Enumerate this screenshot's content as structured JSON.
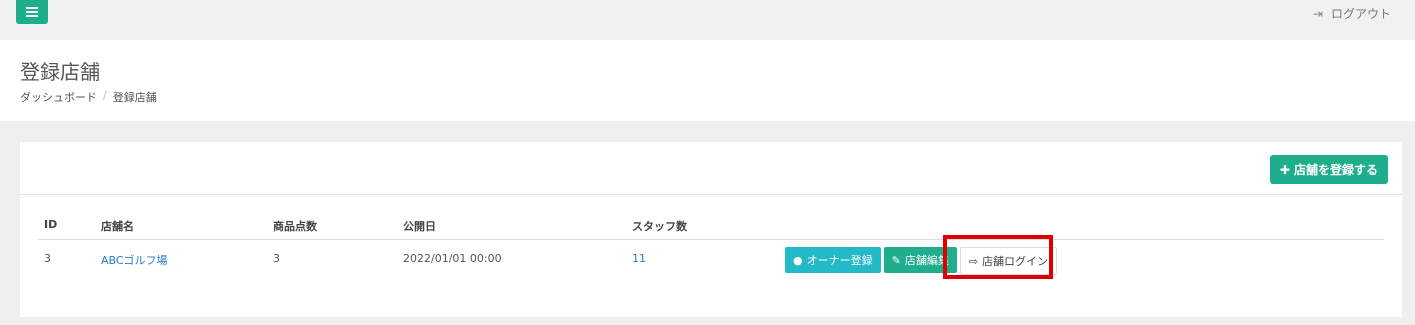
{
  "topbar": {
    "logout_label": "ログアウト"
  },
  "header": {
    "title": "登録店舗",
    "breadcrumb": [
      "ダッシュボード",
      "登録店舗"
    ],
    "breadcrumb_sep": "/"
  },
  "card": {
    "register_button": "店舗を登録する"
  },
  "table": {
    "columns": [
      "ID",
      "店舗名",
      "商品点数",
      "公開日",
      "スタッフ数"
    ],
    "rows": [
      {
        "id": "3",
        "name": "ABCゴルフ場",
        "items": "3",
        "published": "2022/01/01 00:00",
        "staff": "11"
      }
    ],
    "actions": {
      "owner": "オーナー登録",
      "edit": "店舗編集",
      "login": "店舗ログイン"
    }
  },
  "colors": {
    "accent": "#1fae8d",
    "info": "#24b9c7",
    "link": "#2a7ac7",
    "highlight": "#e00000"
  },
  "icons": [
    "menu-icon",
    "logout-icon",
    "plus-icon",
    "user-icon",
    "edit-icon",
    "login-icon"
  ]
}
